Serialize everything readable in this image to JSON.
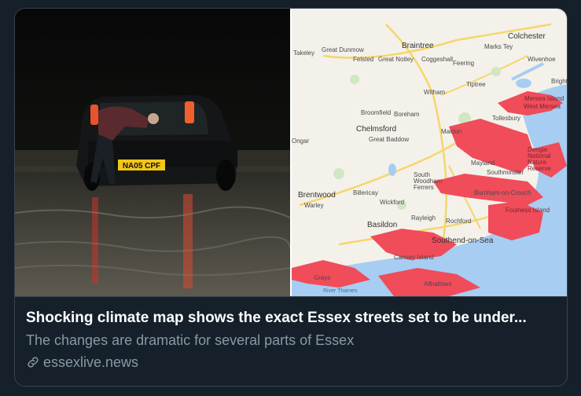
{
  "card": {
    "title": "Shocking climate map shows the exact Essex streets set to be under...",
    "description": "The changes are dramatic for several parts of Essex",
    "domain": "essexlive.news",
    "icons": {
      "link": "link-icon"
    }
  },
  "photo": {
    "plate": "NA05 CPF",
    "alt_subject": "person pushing car through flooded road"
  },
  "map": {
    "places": [
      "Colchester",
      "Braintree",
      "Marks Tey",
      "Takeley",
      "Great Dunmow",
      "Felsted",
      "Great Notley",
      "Coggeshall",
      "Feering",
      "Wivenhoe",
      "Brightlingsea",
      "Tiptree",
      "Witham",
      "Mersea Island",
      "West Mersea",
      "Broomfield",
      "Boreham",
      "Tollesbury",
      "Chelmsford",
      "Maldon",
      "Great Baddow",
      "Dengie National Nature Reserve",
      "Mayland",
      "Southminster",
      "South Woodham Ferrers",
      "Burnham-on-Crouch",
      "Brentwood",
      "Billericay",
      "Warley",
      "Wickford",
      "Foulness Island",
      "Rayleigh",
      "Rochford",
      "Basildon",
      "Southend-on-Sea",
      "Canvey Island",
      "Grays",
      "Allhallows",
      "River Thames",
      "Ongar"
    ],
    "colors": {
      "flood": "#f04c5a",
      "sea": "#a7cdf2",
      "land": "#f4f1ea"
    }
  }
}
